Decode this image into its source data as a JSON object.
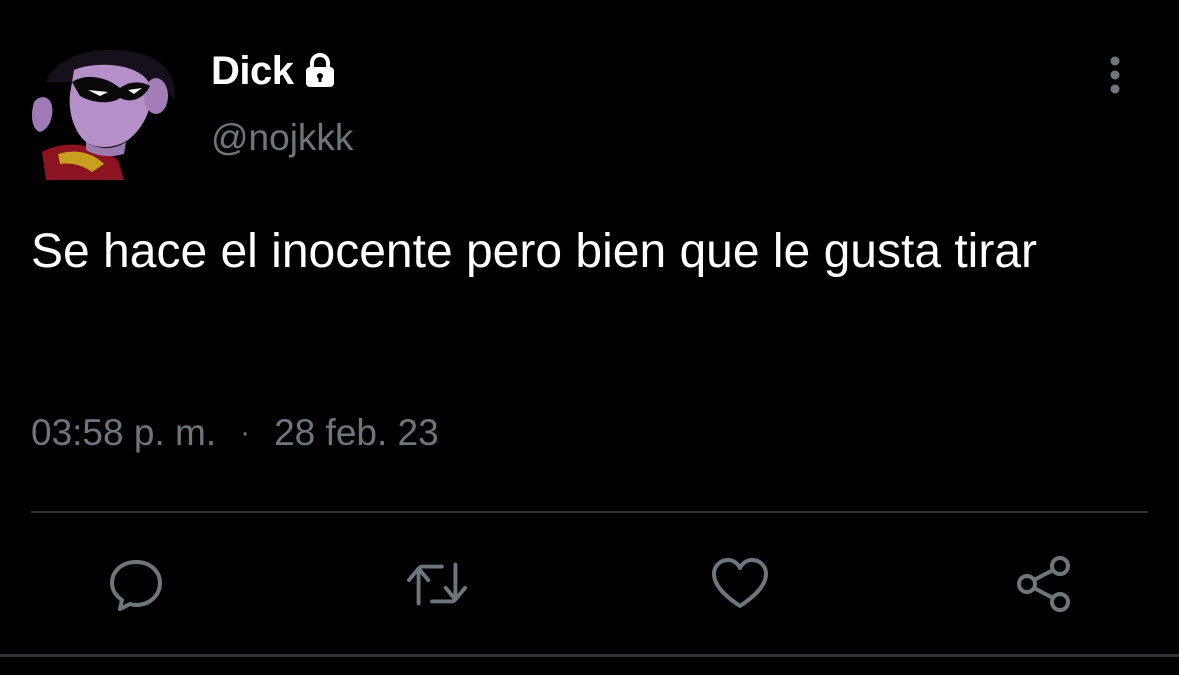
{
  "tweet": {
    "display_name": "Dick",
    "handle": "@nojkkk",
    "text": "Se hace el inocente pero bien que le gusta tirar",
    "time": "03:58 p. m.",
    "separator": "·",
    "date": "28 feb. 23",
    "protected_icon": "lock-icon",
    "more_icon": "more-vertical-icon"
  },
  "actions": [
    {
      "name": "reply",
      "icon": "comment-icon"
    },
    {
      "name": "retweet",
      "icon": "retweet-icon"
    },
    {
      "name": "like",
      "icon": "heart-icon"
    },
    {
      "name": "share",
      "icon": "share-icon"
    }
  ],
  "colors": {
    "background": "#000000",
    "primary_text": "#ffffff",
    "secondary_text": "#6e767d",
    "divider": "#2f3336"
  }
}
